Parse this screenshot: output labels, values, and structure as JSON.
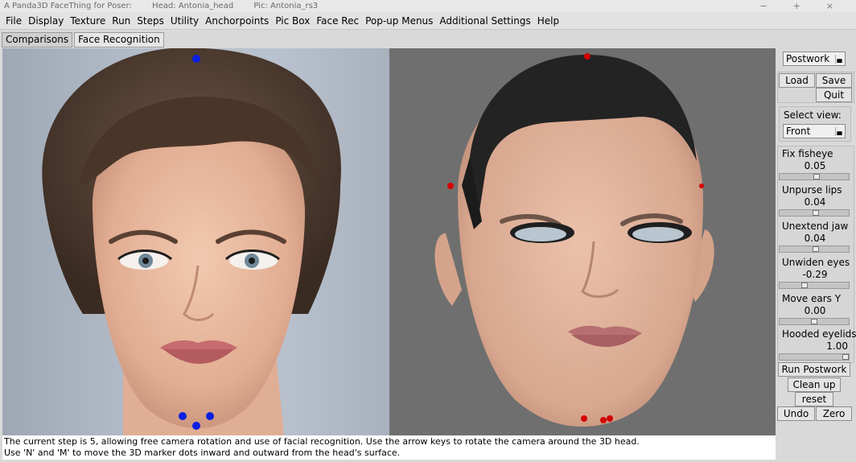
{
  "window": {
    "app_title": "A Panda3D FaceThing for Poser:",
    "head": "Head: Antonia_head",
    "pic": "Pic: Antonia_rs3",
    "controls": [
      "−",
      "+",
      "×"
    ]
  },
  "menu": [
    "File",
    "Display",
    "Texture",
    "Run",
    "Steps",
    "Utility",
    "Anchorpoints",
    "Pic Box",
    "Face Rec",
    "Pop-up Menus",
    "Additional Settings",
    "Help"
  ],
  "tabs": [
    "Comparisons",
    "Face Recognition"
  ],
  "status": {
    "line1": "The current step is 5, allowing free camera rotation and use of facial recognition.  Use the arrow keys to rotate the camera around the 3D head.",
    "line2": "Use 'N' and 'M' to move the 3D marker dots inward and outward from the head's surface."
  },
  "panel": {
    "mode_selected": "Postwork",
    "load_label": "Load",
    "save_label": "Save",
    "quit_label": "Quit",
    "select_view_label": "Select view:",
    "view_selected": "Front",
    "sliders": [
      {
        "label": "Fix fisheye",
        "value": "0.05",
        "level": 0.54
      },
      {
        "label": "Unpurse lips",
        "value": "0.04",
        "level": 0.53
      },
      {
        "label": "Unextend jaw",
        "value": "0.04",
        "level": 0.53
      },
      {
        "label": "Unwiden eyes",
        "value": "-0.29",
        "level": 0.35
      },
      {
        "label": "Move ears Y",
        "value": "0.00",
        "level": 0.5
      },
      {
        "label": "Hooded eyelids",
        "value": "1.00",
        "level": 1.0
      }
    ],
    "run_postwork_label": "Run Postwork",
    "clean_up_label": "Clean up",
    "reset_label": "reset",
    "undo_label": "Undo",
    "zero_label": "Zero"
  },
  "colors": {
    "photo_marker": "#0a1fe0",
    "render_marker": "#d40000",
    "hair": "#232323"
  }
}
